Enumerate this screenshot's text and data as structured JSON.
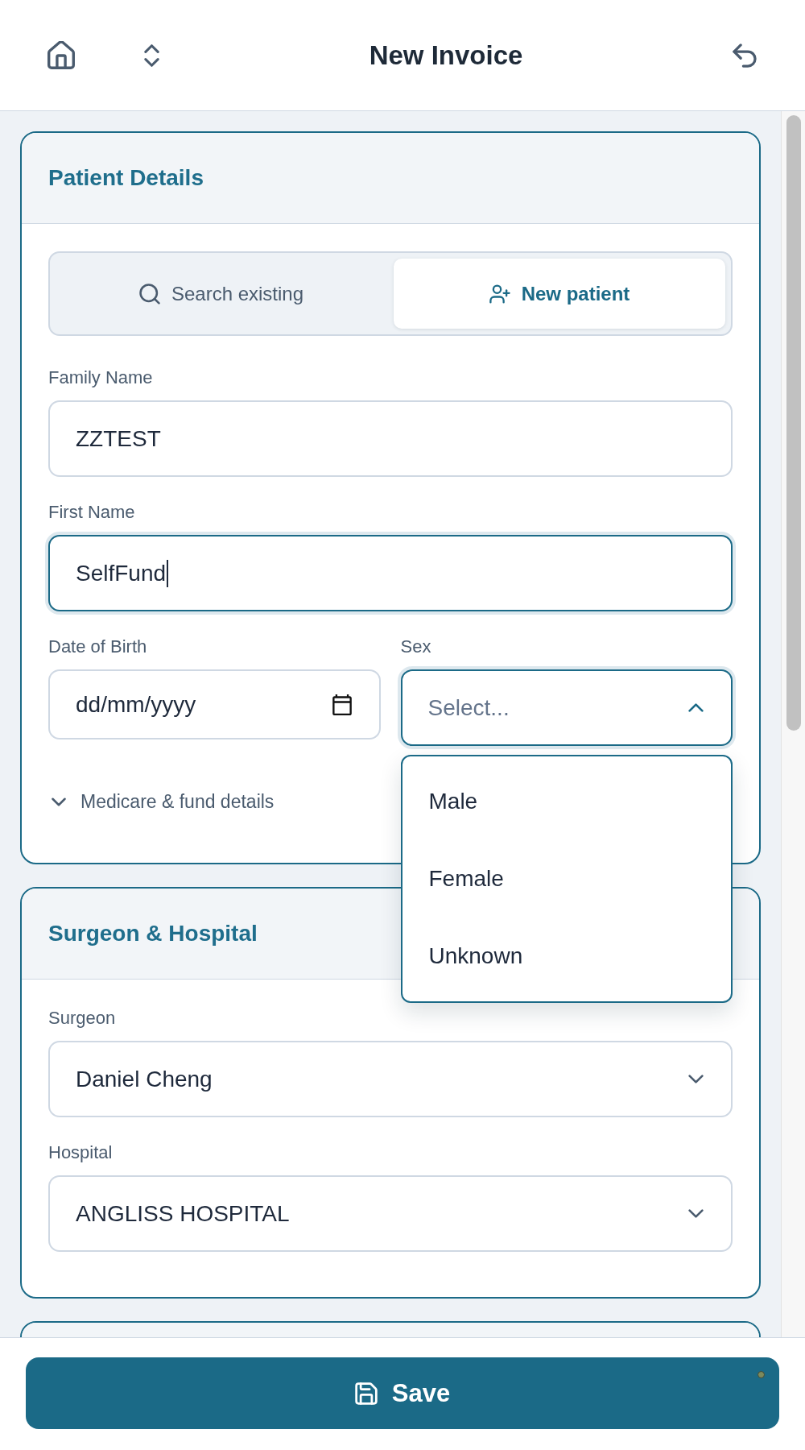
{
  "header": {
    "title": "New Invoice"
  },
  "sections": [
    {
      "title": "Patient Details",
      "mode_tabs": [
        {
          "kind": "search",
          "label": "Search existing",
          "selected": false
        },
        {
          "kind": "new_patient",
          "label": "New patient",
          "selected": true
        }
      ],
      "field_rows": [
        [
          {
            "kind": "text",
            "label": "Family Name",
            "value": "ZZTEST",
            "focused": false
          }
        ],
        [
          {
            "kind": "text",
            "label": "First Name",
            "value": "SelfFund",
            "focused": true
          }
        ],
        [
          {
            "kind": "date",
            "label": "Date of Birth",
            "placeholder": "dd/mm/yyyy",
            "focused": false
          },
          {
            "kind": "select",
            "label": "Sex",
            "placeholder": "Select...",
            "expanded": true,
            "options": [
              {
                "label": "Male",
                "selected": false
              },
              {
                "label": "Female",
                "selected": false
              },
              {
                "label": "Unknown",
                "selected": false
              }
            ]
          }
        ]
      ],
      "collapsible": {
        "label": "Medicare & fund details",
        "expanded": false
      }
    },
    {
      "title": "Surgeon & Hospital",
      "field_rows": [
        [
          {
            "kind": "select",
            "label": "Surgeon",
            "value": "Daniel Cheng",
            "expanded": false
          }
        ],
        [
          {
            "kind": "select",
            "label": "Hospital",
            "value": "ANGLISS HOSPITAL",
            "expanded": false
          }
        ]
      ]
    }
  ],
  "save_button": {
    "label": "Save"
  }
}
